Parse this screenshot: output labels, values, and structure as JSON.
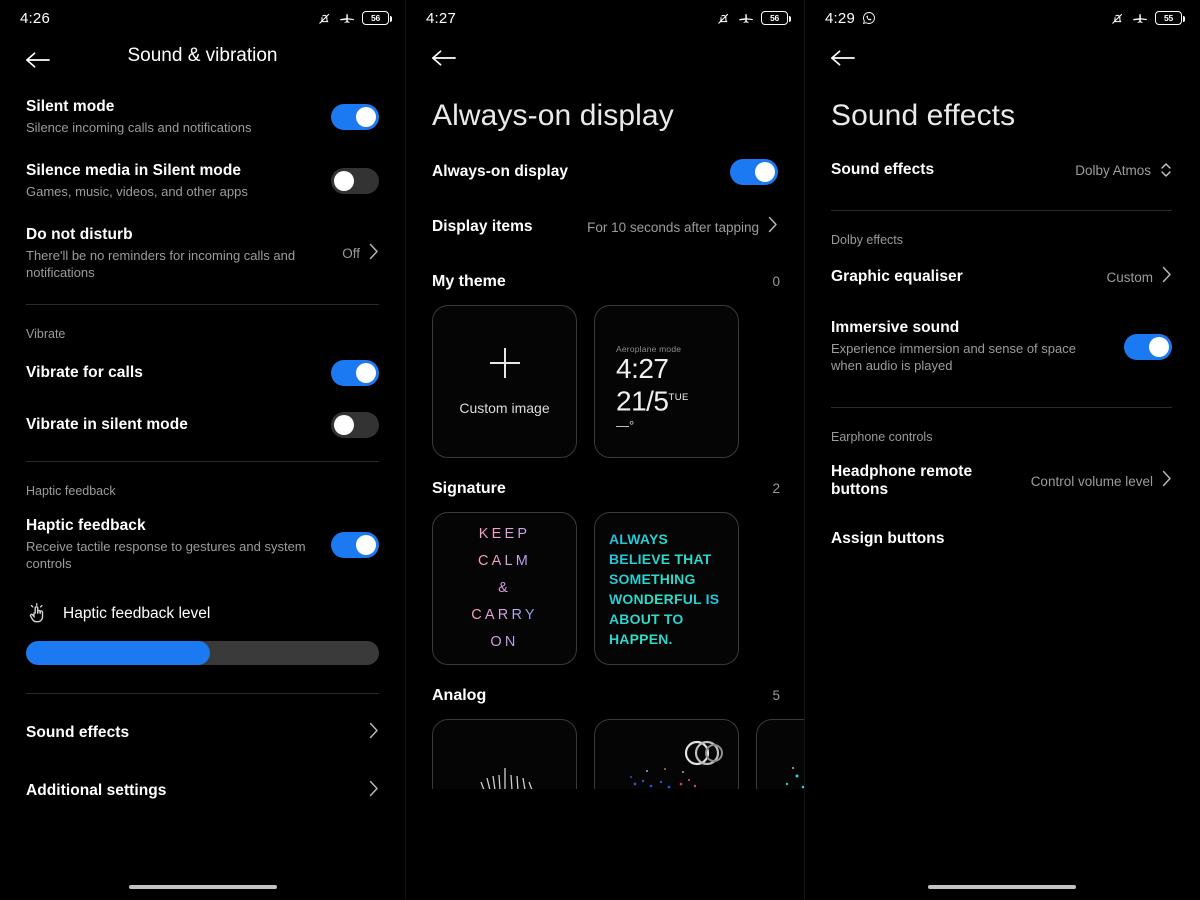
{
  "theme": {
    "accent": "#1b79f2",
    "toggle_off": "#333333",
    "bg": "#000000"
  },
  "panel1": {
    "statusbar": {
      "time": "4:26",
      "battery": "56",
      "icons": [
        "bell-muted-icon",
        "airplane-icon",
        "battery-icon"
      ]
    },
    "header": {
      "title": "Sound & vibration",
      "back": "back-arrow-icon"
    },
    "rows": [
      {
        "title": "Silent mode",
        "sub": "Silence incoming calls and notifications",
        "toggle": "on"
      },
      {
        "title": "Silence media in Silent mode",
        "sub": "Games, music, videos, and other apps",
        "toggle": "off"
      },
      {
        "title": "Do not disturb",
        "sub": "There'll be no reminders for incoming calls and notifications",
        "value": "Off"
      }
    ],
    "vibrate_label": "Vibrate",
    "vibrate_rows": [
      {
        "title": "Vibrate for calls",
        "toggle": "on"
      },
      {
        "title": "Vibrate in silent mode",
        "toggle": "off"
      }
    ],
    "haptic_label": "Haptic feedback",
    "haptic_row": {
      "title": "Haptic feedback",
      "sub": "Receive tactile response to gestures and system controls",
      "toggle": "on"
    },
    "haptic_level": {
      "label": "Haptic feedback level",
      "icon": "tap-vibration-icon",
      "percent": 52
    },
    "links": [
      {
        "title": "Sound effects"
      },
      {
        "title": "Additional settings"
      }
    ]
  },
  "panel2": {
    "statusbar": {
      "time": "4:27",
      "battery": "56",
      "icons": [
        "bell-muted-icon",
        "airplane-icon",
        "battery-icon"
      ]
    },
    "header": {
      "title": "Always-on display",
      "back": "back-arrow-icon"
    },
    "rows": [
      {
        "title": "Always-on display",
        "toggle": "on"
      },
      {
        "title": "Display items",
        "value": "For 10 seconds after tapping"
      }
    ],
    "sections": [
      {
        "name": "My theme",
        "count": "0",
        "cards": [
          {
            "type": "custom-image",
            "label": "Custom image",
            "icon": "plus-icon"
          },
          {
            "type": "clock",
            "status": "Aeroplane mode",
            "time": "4:27",
            "date": "21/5",
            "weekday": "TUE",
            "temp": "—°"
          }
        ]
      },
      {
        "name": "Signature",
        "count": "2",
        "cards": [
          {
            "type": "signature",
            "lines": [
              "KEEP",
              "CALM",
              "&",
              "CARRY",
              "ON"
            ]
          },
          {
            "type": "signature2",
            "text": "ALWAYS BELIEVE THAT SOMETHING WONDERFUL IS ABOUT TO HAPPEN."
          }
        ]
      },
      {
        "name": "Analog",
        "count": "5",
        "cards": [
          {
            "type": "analog-dial"
          },
          {
            "type": "analog-rings"
          },
          {
            "type": "analog-dots"
          }
        ]
      }
    ]
  },
  "panel3": {
    "statusbar": {
      "time": "4:29",
      "battery": "55",
      "icons": [
        "whatsapp-icon",
        "bell-muted-icon",
        "airplane-icon",
        "battery-icon"
      ]
    },
    "header": {
      "title": "Sound effects",
      "back": "back-arrow-icon"
    },
    "main_row": {
      "title": "Sound effects",
      "value": "Dolby Atmos",
      "control": "chevron-updown-icon"
    },
    "dolby_label": "Dolby effects",
    "dolby_rows": [
      {
        "title": "Graphic equaliser",
        "value": "Custom"
      },
      {
        "title": "Immersive sound",
        "sub": "Experience immersion and sense of space when audio is played",
        "toggle": "on"
      }
    ],
    "earphone_label": "Earphone controls",
    "earphone_rows": [
      {
        "title": "Headphone remote buttons",
        "value": "Control volume level"
      },
      {
        "title": "Assign buttons"
      }
    ]
  }
}
